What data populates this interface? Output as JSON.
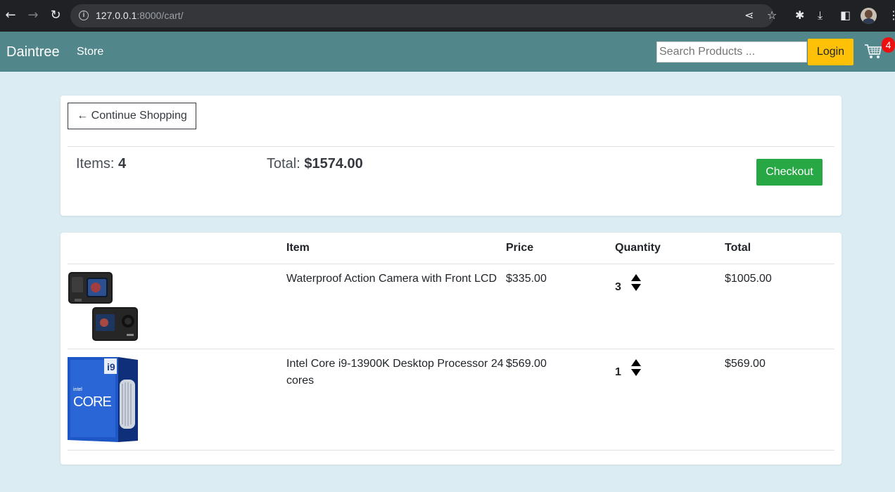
{
  "browser": {
    "url_host": "127.0.0.1",
    "url_rest": ":8000/cart/"
  },
  "navbar": {
    "brand": "Daintree",
    "store_link": "Store",
    "search_placeholder": "Search Products ...",
    "login_label": "Login",
    "cart_count": "4"
  },
  "summary": {
    "back_label": "← Continue Shopping",
    "items_label": "Items: ",
    "items_value": "4",
    "total_label": "Total: ",
    "total_value": "$1574.00",
    "checkout_label": "Checkout"
  },
  "table": {
    "headers": [
      "Item",
      "Price",
      "Quantity",
      "Total"
    ],
    "rows": [
      {
        "item": "Waterproof Action Camera with Front LCD",
        "price": "$335.00",
        "quantity": "3",
        "total": "$1005.00",
        "image": "action-camera"
      },
      {
        "item": "Intel Core i9-13900K Desktop Processor 24 cores",
        "price": "$569.00",
        "quantity": "1",
        "total": "$569.00",
        "image": "cpu-box"
      }
    ]
  },
  "colors": {
    "navbar": "#51878b",
    "page_bg": "#dbecf3",
    "login": "#ffc107",
    "checkout": "#28a745",
    "badge": "#ee1010"
  }
}
